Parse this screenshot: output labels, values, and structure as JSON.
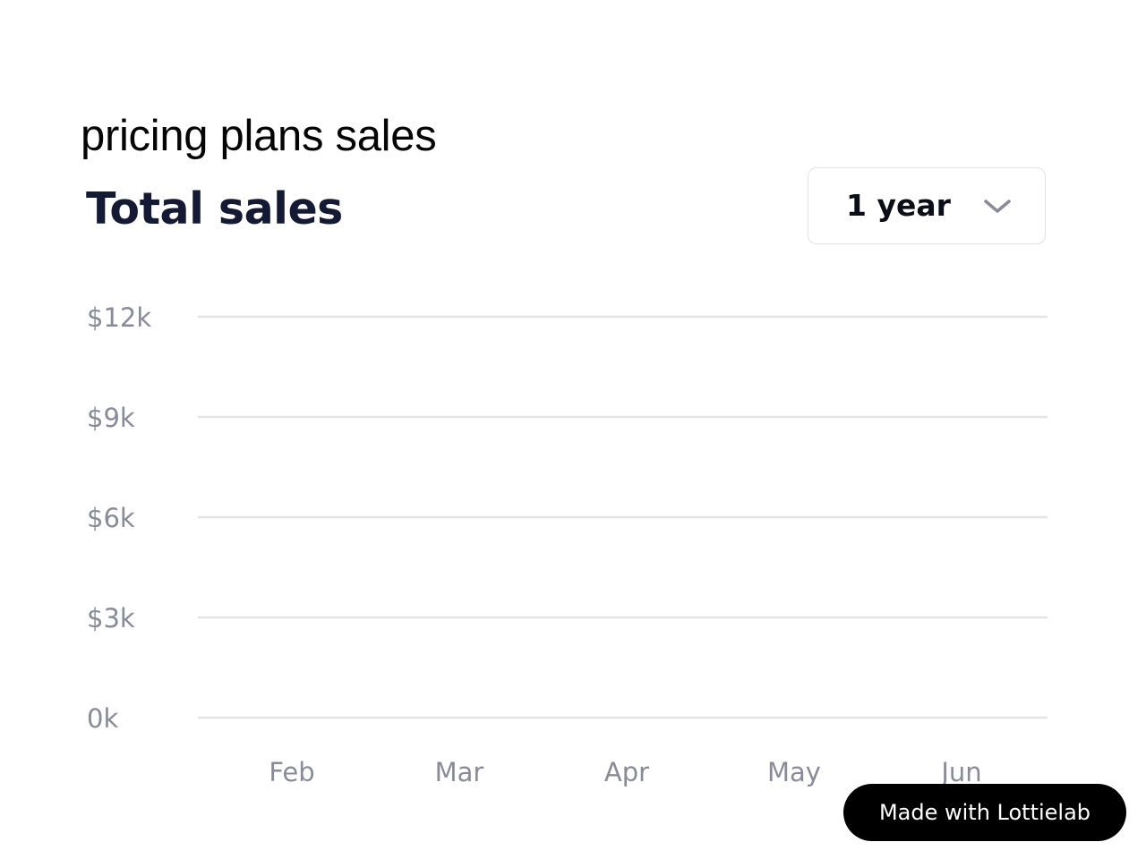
{
  "caption": "pricing plans sales",
  "range_select": {
    "value": "1 year",
    "icon": "chevron-down-icon"
  },
  "badge": {
    "label": "Made with Lottielab"
  },
  "colors": {
    "title": "#141a33",
    "tick_labels": "#8a8b99",
    "gridlines": "#e4e4e8",
    "badge_background": "#000000"
  },
  "chart_data": {
    "type": "line",
    "title": "Total sales",
    "categories": [
      "Feb",
      "Mar",
      "Apr",
      "May",
      "Jun"
    ],
    "series": [],
    "ylim": [
      0,
      12000
    ],
    "y_ticks": [
      {
        "value": 12000,
        "label": "$12k"
      },
      {
        "value": 9000,
        "label": "$9k"
      },
      {
        "value": 6000,
        "label": "$6k"
      },
      {
        "value": 3000,
        "label": "$3k"
      },
      {
        "value": 0,
        "label": "0k"
      }
    ],
    "xlabel": "",
    "ylabel": "",
    "grid": "horizontal",
    "legend": "none"
  }
}
